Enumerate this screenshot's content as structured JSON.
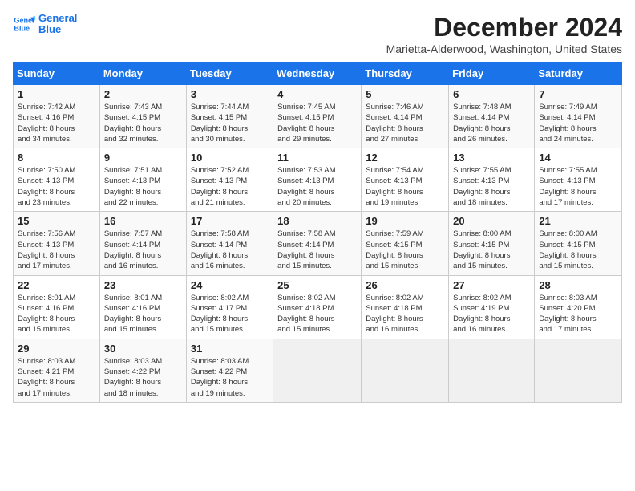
{
  "logo": {
    "line1": "General",
    "line2": "Blue"
  },
  "title": "December 2024",
  "subtitle": "Marietta-Alderwood, Washington, United States",
  "weekdays": [
    "Sunday",
    "Monday",
    "Tuesday",
    "Wednesday",
    "Thursday",
    "Friday",
    "Saturday"
  ],
  "weeks": [
    [
      {
        "day": 1,
        "sunrise": "7:42 AM",
        "sunset": "4:16 PM",
        "daylight": "8 hours and 34 minutes."
      },
      {
        "day": 2,
        "sunrise": "7:43 AM",
        "sunset": "4:15 PM",
        "daylight": "8 hours and 32 minutes."
      },
      {
        "day": 3,
        "sunrise": "7:44 AM",
        "sunset": "4:15 PM",
        "daylight": "8 hours and 30 minutes."
      },
      {
        "day": 4,
        "sunrise": "7:45 AM",
        "sunset": "4:15 PM",
        "daylight": "8 hours and 29 minutes."
      },
      {
        "day": 5,
        "sunrise": "7:46 AM",
        "sunset": "4:14 PM",
        "daylight": "8 hours and 27 minutes."
      },
      {
        "day": 6,
        "sunrise": "7:48 AM",
        "sunset": "4:14 PM",
        "daylight": "8 hours and 26 minutes."
      },
      {
        "day": 7,
        "sunrise": "7:49 AM",
        "sunset": "4:14 PM",
        "daylight": "8 hours and 24 minutes."
      }
    ],
    [
      {
        "day": 8,
        "sunrise": "7:50 AM",
        "sunset": "4:13 PM",
        "daylight": "8 hours and 23 minutes."
      },
      {
        "day": 9,
        "sunrise": "7:51 AM",
        "sunset": "4:13 PM",
        "daylight": "8 hours and 22 minutes."
      },
      {
        "day": 10,
        "sunrise": "7:52 AM",
        "sunset": "4:13 PM",
        "daylight": "8 hours and 21 minutes."
      },
      {
        "day": 11,
        "sunrise": "7:53 AM",
        "sunset": "4:13 PM",
        "daylight": "8 hours and 20 minutes."
      },
      {
        "day": 12,
        "sunrise": "7:54 AM",
        "sunset": "4:13 PM",
        "daylight": "8 hours and 19 minutes."
      },
      {
        "day": 13,
        "sunrise": "7:55 AM",
        "sunset": "4:13 PM",
        "daylight": "8 hours and 18 minutes."
      },
      {
        "day": 14,
        "sunrise": "7:55 AM",
        "sunset": "4:13 PM",
        "daylight": "8 hours and 17 minutes."
      }
    ],
    [
      {
        "day": 15,
        "sunrise": "7:56 AM",
        "sunset": "4:13 PM",
        "daylight": "8 hours and 17 minutes."
      },
      {
        "day": 16,
        "sunrise": "7:57 AM",
        "sunset": "4:14 PM",
        "daylight": "8 hours and 16 minutes."
      },
      {
        "day": 17,
        "sunrise": "7:58 AM",
        "sunset": "4:14 PM",
        "daylight": "8 hours and 16 minutes."
      },
      {
        "day": 18,
        "sunrise": "7:58 AM",
        "sunset": "4:14 PM",
        "daylight": "8 hours and 15 minutes."
      },
      {
        "day": 19,
        "sunrise": "7:59 AM",
        "sunset": "4:15 PM",
        "daylight": "8 hours and 15 minutes."
      },
      {
        "day": 20,
        "sunrise": "8:00 AM",
        "sunset": "4:15 PM",
        "daylight": "8 hours and 15 minutes."
      },
      {
        "day": 21,
        "sunrise": "8:00 AM",
        "sunset": "4:15 PM",
        "daylight": "8 hours and 15 minutes."
      }
    ],
    [
      {
        "day": 22,
        "sunrise": "8:01 AM",
        "sunset": "4:16 PM",
        "daylight": "8 hours and 15 minutes."
      },
      {
        "day": 23,
        "sunrise": "8:01 AM",
        "sunset": "4:16 PM",
        "daylight": "8 hours and 15 minutes."
      },
      {
        "day": 24,
        "sunrise": "8:02 AM",
        "sunset": "4:17 PM",
        "daylight": "8 hours and 15 minutes."
      },
      {
        "day": 25,
        "sunrise": "8:02 AM",
        "sunset": "4:18 PM",
        "daylight": "8 hours and 15 minutes."
      },
      {
        "day": 26,
        "sunrise": "8:02 AM",
        "sunset": "4:18 PM",
        "daylight": "8 hours and 16 minutes."
      },
      {
        "day": 27,
        "sunrise": "8:02 AM",
        "sunset": "4:19 PM",
        "daylight": "8 hours and 16 minutes."
      },
      {
        "day": 28,
        "sunrise": "8:03 AM",
        "sunset": "4:20 PM",
        "daylight": "8 hours and 17 minutes."
      }
    ],
    [
      {
        "day": 29,
        "sunrise": "8:03 AM",
        "sunset": "4:21 PM",
        "daylight": "8 hours and 17 minutes."
      },
      {
        "day": 30,
        "sunrise": "8:03 AM",
        "sunset": "4:22 PM",
        "daylight": "8 hours and 18 minutes."
      },
      {
        "day": 31,
        "sunrise": "8:03 AM",
        "sunset": "4:22 PM",
        "daylight": "8 hours and 19 minutes."
      },
      null,
      null,
      null,
      null
    ]
  ],
  "labels": {
    "sunrise": "Sunrise:",
    "sunset": "Sunset:",
    "daylight": "Daylight:"
  }
}
